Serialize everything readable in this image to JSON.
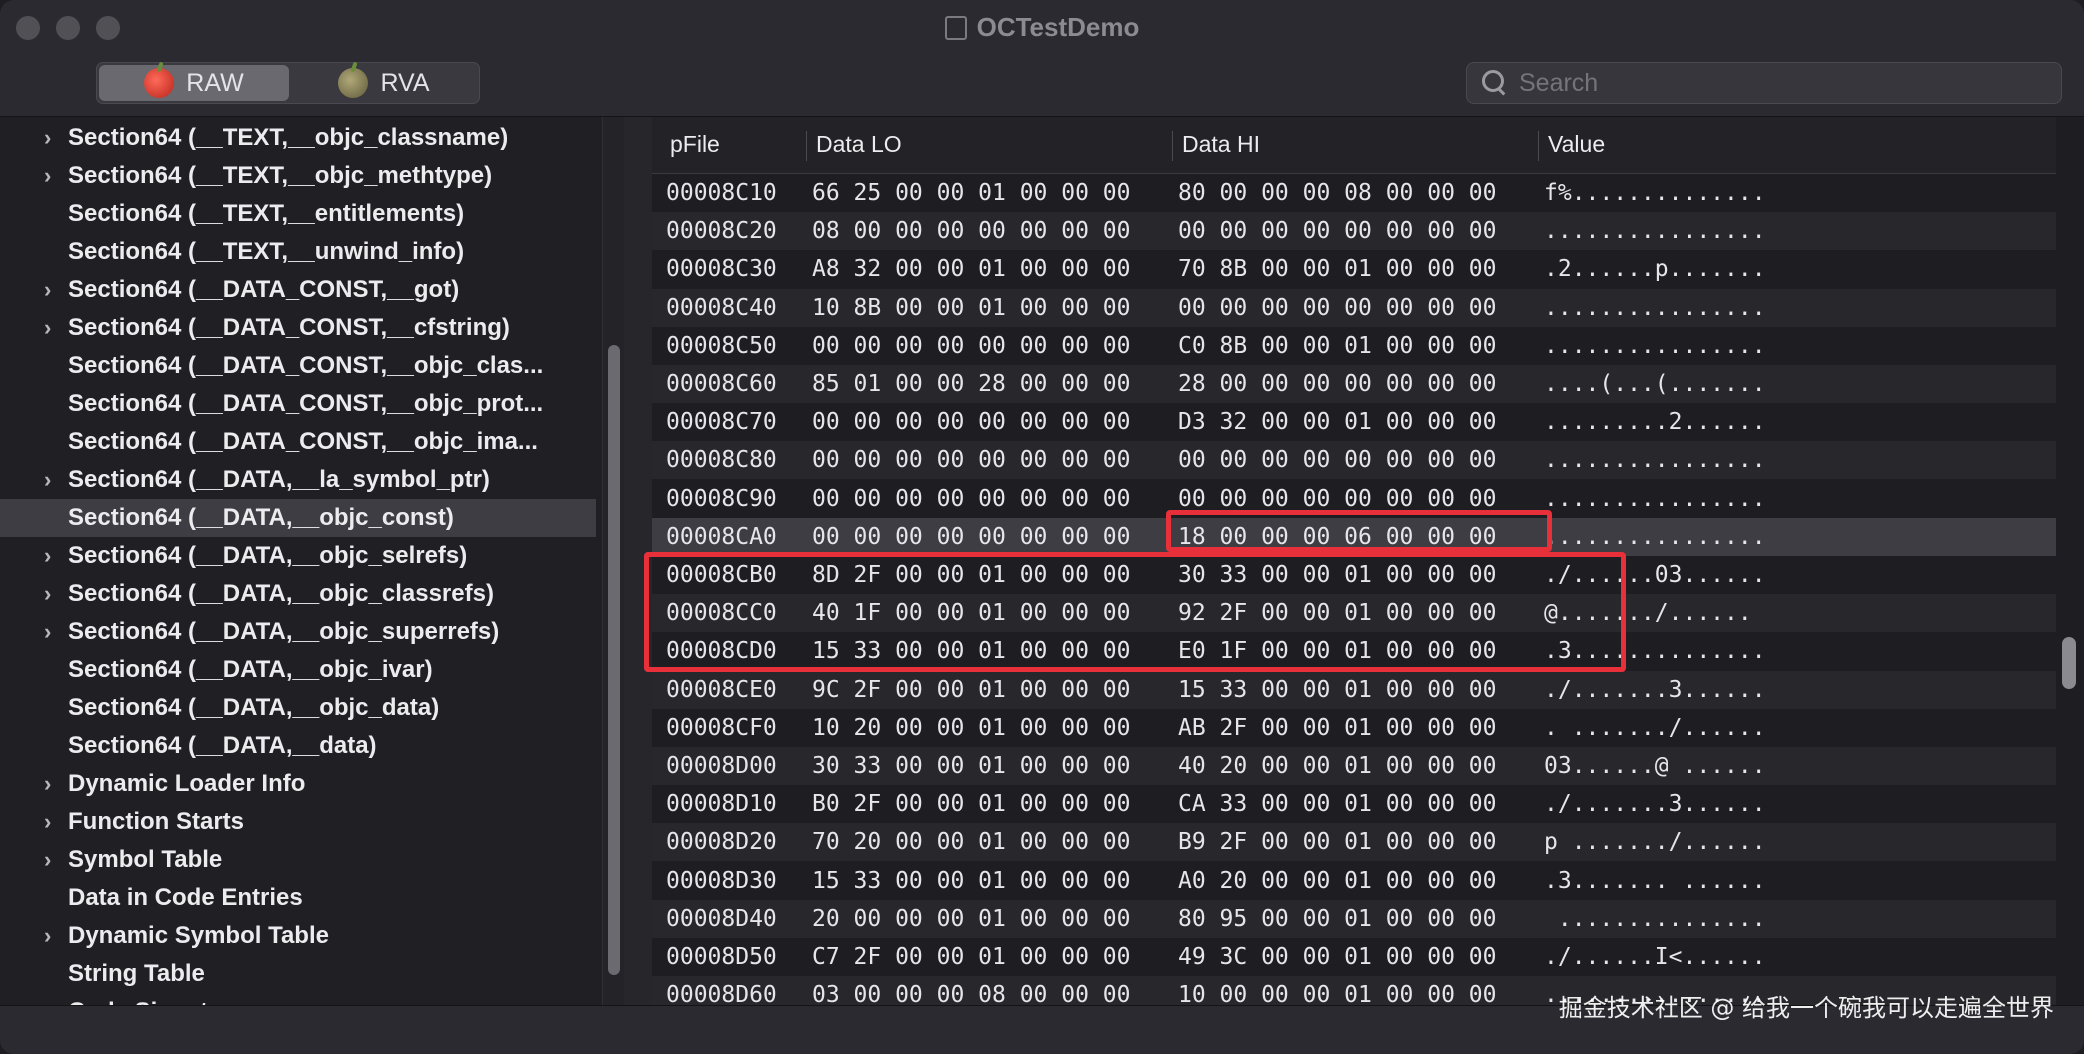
{
  "window": {
    "title": "OCTestDemo"
  },
  "toolbar": {
    "modes": [
      {
        "label": "RAW",
        "active": true
      },
      {
        "label": "RVA",
        "active": false
      }
    ],
    "search": {
      "placeholder": "Search",
      "value": ""
    }
  },
  "sidebar": {
    "items": [
      {
        "label": "Section64 (__TEXT,__objc_classname)",
        "expandable": true
      },
      {
        "label": "Section64 (__TEXT,__objc_methtype)",
        "expandable": true
      },
      {
        "label": "Section64 (__TEXT,__entitlements)",
        "expandable": false
      },
      {
        "label": "Section64 (__TEXT,__unwind_info)",
        "expandable": false
      },
      {
        "label": "Section64 (__DATA_CONST,__got)",
        "expandable": true
      },
      {
        "label": "Section64 (__DATA_CONST,__cfstring)",
        "expandable": true
      },
      {
        "label": "Section64 (__DATA_CONST,__objc_clas...",
        "expandable": false
      },
      {
        "label": "Section64 (__DATA_CONST,__objc_prot...",
        "expandable": false
      },
      {
        "label": "Section64 (__DATA_CONST,__objc_ima...",
        "expandable": false
      },
      {
        "label": "Section64 (__DATA,__la_symbol_ptr)",
        "expandable": true
      },
      {
        "label": "Section64 (__DATA,__objc_const)",
        "expandable": false,
        "selected": true
      },
      {
        "label": "Section64 (__DATA,__objc_selrefs)",
        "expandable": true
      },
      {
        "label": "Section64 (__DATA,__objc_classrefs)",
        "expandable": true
      },
      {
        "label": "Section64 (__DATA,__objc_superrefs)",
        "expandable": true
      },
      {
        "label": "Section64 (__DATA,__objc_ivar)",
        "expandable": false
      },
      {
        "label": "Section64 (__DATA,__objc_data)",
        "expandable": false
      },
      {
        "label": "Section64 (__DATA,__data)",
        "expandable": false
      },
      {
        "label": "Dynamic Loader Info",
        "expandable": true
      },
      {
        "label": "Function Starts",
        "expandable": true
      },
      {
        "label": "Symbol Table",
        "expandable": true
      },
      {
        "label": "Data in Code Entries",
        "expandable": false
      },
      {
        "label": "Dynamic Symbol Table",
        "expandable": true
      },
      {
        "label": "String Table",
        "expandable": false
      },
      {
        "label": "Code Signature",
        "expandable": false
      }
    ]
  },
  "hex_table": {
    "columns": [
      "pFile",
      "Data LO",
      "Data HI",
      "Value"
    ],
    "rows": [
      {
        "pfile": "00008C10",
        "lo": "66 25 00 00 01 00 00 00",
        "hi": "80 00 00 00 08 00 00 00",
        "value": "f%.............."
      },
      {
        "pfile": "00008C20",
        "lo": "08 00 00 00 00 00 00 00",
        "hi": "00 00 00 00 00 00 00 00",
        "value": "................"
      },
      {
        "pfile": "00008C30",
        "lo": "A8 32 00 00 01 00 00 00",
        "hi": "70 8B 00 00 01 00 00 00",
        "value": ".2......p......."
      },
      {
        "pfile": "00008C40",
        "lo": "10 8B 00 00 01 00 00 00",
        "hi": "00 00 00 00 00 00 00 00",
        "value": "................"
      },
      {
        "pfile": "00008C50",
        "lo": "00 00 00 00 00 00 00 00",
        "hi": "C0 8B 00 00 01 00 00 00",
        "value": "................"
      },
      {
        "pfile": "00008C60",
        "lo": "85 01 00 00 28 00 00 00",
        "hi": "28 00 00 00 00 00 00 00",
        "value": "....(...(......."
      },
      {
        "pfile": "00008C70",
        "lo": "00 00 00 00 00 00 00 00",
        "hi": "D3 32 00 00 01 00 00 00",
        "value": ".........2......"
      },
      {
        "pfile": "00008C80",
        "lo": "00 00 00 00 00 00 00 00",
        "hi": "00 00 00 00 00 00 00 00",
        "value": "................"
      },
      {
        "pfile": "00008C90",
        "lo": "00 00 00 00 00 00 00 00",
        "hi": "00 00 00 00 00 00 00 00",
        "value": "................"
      },
      {
        "pfile": "00008CA0",
        "lo": "00 00 00 00 00 00 00 00",
        "hi": "18 00 00 00 06 00 00 00",
        "value": "................",
        "selected": true
      },
      {
        "pfile": "00008CB0",
        "lo": "8D 2F 00 00 01 00 00 00",
        "hi": "30 33 00 00 01 00 00 00",
        "value": "./......03......"
      },
      {
        "pfile": "00008CC0",
        "lo": "40 1F 00 00 01 00 00 00",
        "hi": "92 2F 00 00 01 00 00 00",
        "value": "@......./......"
      },
      {
        "pfile": "00008CD0",
        "lo": "15 33 00 00 01 00 00 00",
        "hi": "E0 1F 00 00 01 00 00 00",
        "value": ".3.............."
      },
      {
        "pfile": "00008CE0",
        "lo": "9C 2F 00 00 01 00 00 00",
        "hi": "15 33 00 00 01 00 00 00",
        "value": "./.......3......"
      },
      {
        "pfile": "00008CF0",
        "lo": "10 20 00 00 01 00 00 00",
        "hi": "AB 2F 00 00 01 00 00 00",
        "value": ". ......./......"
      },
      {
        "pfile": "00008D00",
        "lo": "30 33 00 00 01 00 00 00",
        "hi": "40 20 00 00 01 00 00 00",
        "value": "03......@ ......"
      },
      {
        "pfile": "00008D10",
        "lo": "B0 2F 00 00 01 00 00 00",
        "hi": "CA 33 00 00 01 00 00 00",
        "value": "./.......3......"
      },
      {
        "pfile": "00008D20",
        "lo": "70 20 00 00 01 00 00 00",
        "hi": "B9 2F 00 00 01 00 00 00",
        "value": "p ......./......"
      },
      {
        "pfile": "00008D30",
        "lo": "15 33 00 00 01 00 00 00",
        "hi": "A0 20 00 00 01 00 00 00",
        "value": ".3....... ......"
      },
      {
        "pfile": "00008D40",
        "lo": "20 00 00 00 01 00 00 00",
        "hi": "80 95 00 00 01 00 00 00",
        "value": " ..............."
      },
      {
        "pfile": "00008D50",
        "lo": "C7 2F 00 00 01 00 00 00",
        "hi": "49 3C 00 00 01 00 00 00",
        "value": "./......I<......"
      },
      {
        "pfile": "00008D60",
        "lo": "03 00 00 00 08 00 00 00",
        "hi": "10 00 00 00 01 00 00 00",
        "value": "................"
      }
    ]
  },
  "annotation_color": "#e8303a",
  "watermark": "掘金技术社区 @ 给我一个碗我可以走遍全世界"
}
